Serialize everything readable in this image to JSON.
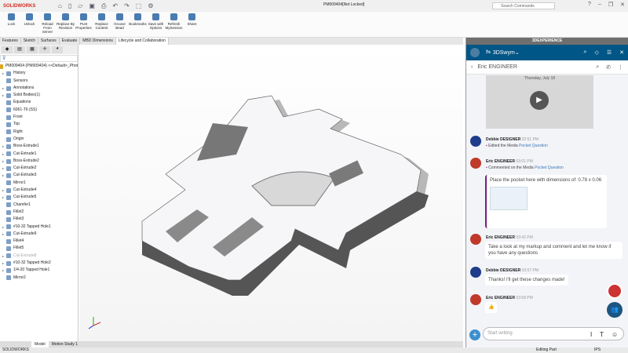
{
  "app": {
    "brand": "SOLIDWORKS",
    "document_title": "PM009404[Not Locked]",
    "search_placeholder": "Search Commands"
  },
  "ribbon": [
    "Lock",
    "Unlock",
    "Reload From Server",
    "Replace By Revision",
    "PLM Properties",
    "Replace Content",
    "Groove Bead",
    "Bookmarks",
    "Save with Options",
    "Refresh MySession",
    "Share"
  ],
  "tabs": [
    "Features",
    "Sketch",
    "Surfaces",
    "Evaluate",
    "MBD Dimensions",
    "Lifecycle and Collaboration"
  ],
  "tree": {
    "root": "PM009404 (PM009404) <<Default>_Phot",
    "items": [
      {
        "label": "History",
        "arrow": true
      },
      {
        "label": "Sensors",
        "arrow": false
      },
      {
        "label": "Annotations",
        "arrow": true
      },
      {
        "label": "Solid Bodies(1)",
        "arrow": true
      },
      {
        "label": "Equations",
        "arrow": false
      },
      {
        "label": "6061-T6 (SS)",
        "arrow": false
      },
      {
        "label": "Front",
        "arrow": false
      },
      {
        "label": "Top",
        "arrow": false
      },
      {
        "label": "Right",
        "arrow": false
      },
      {
        "label": "Origin",
        "arrow": false
      },
      {
        "label": "Boss-Extrude1",
        "arrow": true
      },
      {
        "label": "Cut-Extrude1",
        "arrow": true
      },
      {
        "label": "Boss-Extrude2",
        "arrow": true
      },
      {
        "label": "Cut-Extrude2",
        "arrow": true
      },
      {
        "label": "Cut-Extrude3",
        "arrow": true
      },
      {
        "label": "Mirror1",
        "arrow": false
      },
      {
        "label": "Cut-Extrude4",
        "arrow": true
      },
      {
        "label": "Cut-Extrude5",
        "arrow": true
      },
      {
        "label": "Chamfer1",
        "arrow": false
      },
      {
        "label": "Fillet2",
        "arrow": false
      },
      {
        "label": "Fillet3",
        "arrow": false
      },
      {
        "label": "#10-32 Tapped Hole1",
        "arrow": true
      },
      {
        "label": "Cut-Extrude9",
        "arrow": true
      },
      {
        "label": "Fillet4",
        "arrow": false
      },
      {
        "label": "Fillet5",
        "arrow": false
      },
      {
        "label": "Cut-Extrude8",
        "arrow": true,
        "dim": true
      },
      {
        "label": "#10-32 Tapped Hole2",
        "arrow": true
      },
      {
        "label": "1/4-20 Tapped Hole1",
        "arrow": true
      },
      {
        "label": "Mirror2",
        "arrow": false
      }
    ]
  },
  "bottom_tabs": [
    "Model",
    "Motion Study 1"
  ],
  "status": {
    "app": "SOLIDWORKS",
    "mode": "Editing Part",
    "units": "IPS"
  },
  "panel": {
    "title": "3DEXPERIENCE",
    "app_name": "3DSwym",
    "contact": "Eric ENGINEER",
    "video_date": "Thursday, July 18",
    "input_placeholder": "Start writing",
    "messages": [
      {
        "name": "Debbie DESIGNER",
        "time": "02:51 PM",
        "action": "Edited the Media",
        "link": "Pocket Question"
      },
      {
        "name": "Eric ENGINEER",
        "time": "03:01 PM",
        "action": "Commented on the Media",
        "link": "Pocket Question",
        "text": "Place the pocket here with dimensions of:  0.78 x 0.06"
      },
      {
        "name": "Eric ENGINEER",
        "time": "03:42 PM",
        "text": "Take a look at my markup and comment and let me know if you have any questions"
      },
      {
        "name": "Debbie DESIGNER",
        "time": "03:57 PM",
        "text": "Thanks!  I'll get these changes made!"
      },
      {
        "name": "Eric ENGINEER",
        "time": "03:58 PM",
        "text": "👍"
      }
    ]
  },
  "colors": {
    "brand_red": "#d52b1e",
    "panel_blue": "#005686",
    "link": "#3a78b5"
  }
}
